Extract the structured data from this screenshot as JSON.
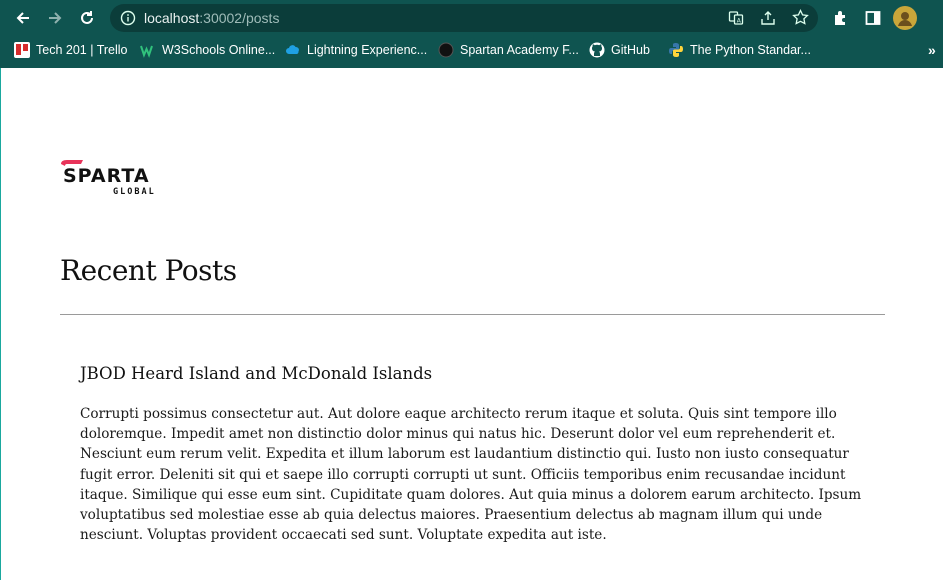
{
  "browser": {
    "url_host": "localhost",
    "url_rest": ":30002/posts",
    "colors": {
      "frame": "#0f5450",
      "omnibox": "#0b3d3a"
    },
    "icons": [
      "back-icon",
      "forward-icon",
      "reload-icon",
      "site-info-icon",
      "translate-icon",
      "share-icon",
      "star-icon",
      "extensions-icon",
      "sidepanel-icon",
      "profile-avatar-icon"
    ],
    "bookmarks": [
      {
        "label": "Tech 201 | Trello",
        "icon": "trello-icon"
      },
      {
        "label": "W3Schools Online...",
        "icon": "w3schools-icon"
      },
      {
        "label": "Lightning Experienc...",
        "icon": "salesforce-cloud-icon"
      },
      {
        "label": "Spartan Academy F...",
        "icon": "spartan-academy-icon"
      },
      {
        "label": "GitHub",
        "icon": "github-icon"
      },
      {
        "label": "The Python Standar...",
        "icon": "python-icon"
      }
    ],
    "overflow": "»"
  },
  "page": {
    "logo": {
      "word": "SPARTA",
      "sub": "GLOBAL",
      "accent": "#e8345a"
    },
    "title": "Recent Posts",
    "posts": [
      {
        "title": "JBOD Heard Island and McDonald Islands",
        "body": "Corrupti possimus consectetur aut. Aut dolore eaque architecto rerum itaque et soluta. Quis sint tempore illo doloremque. Impedit amet non distinctio dolor minus qui natus hic. Deserunt dolor vel eum reprehenderit et. Nesciunt eum rerum velit. Expedita et illum laborum est laudantium distinctio qui. Iusto non iusto consequatur fugit error. Deleniti sit qui et saepe illo corrupti corrupti ut sunt. Officiis temporibus enim recusandae incidunt itaque. Similique qui esse eum sint. Cupiditate quam dolores. Aut quia minus a dolorem earum architecto. Ipsum voluptatibus sed molestiae esse ab quia delectus maiores. Praesentium delectus ab magnam illum qui unde nesciunt. Voluptas provident occaecati sed sunt. Voluptate expedita aut iste."
      }
    ]
  }
}
